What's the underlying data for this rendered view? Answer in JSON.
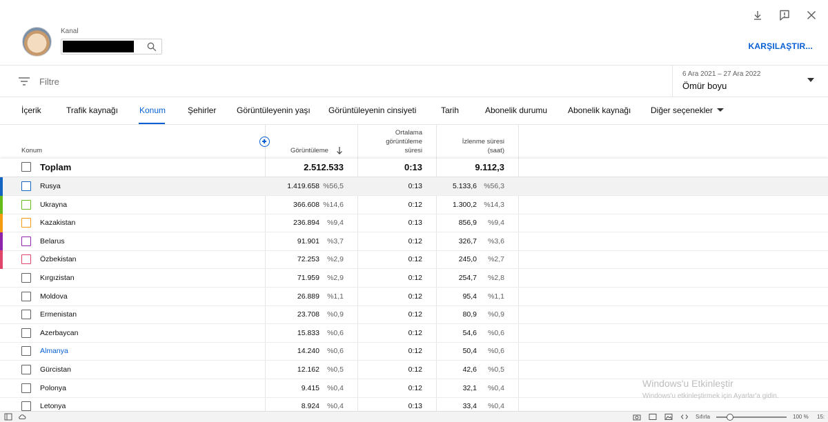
{
  "header": {
    "channel_label": "Kanal",
    "compare_label": "KARŞILAŞTIR..."
  },
  "filter": {
    "placeholder": "Filtre",
    "date_range_sub": "6 Ara 2021 – 27 Ara 2022",
    "date_range_main": "Ömür boyu"
  },
  "tabs": [
    {
      "label": "İçerik"
    },
    {
      "label": "Trafik kaynağı"
    },
    {
      "label": "Konum",
      "active": true
    },
    {
      "label": "Şehirler"
    },
    {
      "label": "Görüntüleyenin yaşı"
    },
    {
      "label": "Görüntüleyenin cinsiyeti"
    },
    {
      "label": "Tarih"
    },
    {
      "label": "Abonelik durumu"
    },
    {
      "label": "Abonelik kaynağı"
    },
    {
      "label": "Diğer seçenekler"
    }
  ],
  "table": {
    "col_location": "Konum",
    "col_views": "Görüntüleme",
    "col_avg_l1": "Ortalama",
    "col_avg_l2": "görüntüleme",
    "col_avg_l3": "süresi",
    "col_watch_l1": "İzlenme süresi",
    "col_watch_l2": "(saat)",
    "total": {
      "name": "Toplam",
      "views": "2.512.533",
      "avg": "0:13",
      "watch": "9.112,3"
    },
    "rows": [
      {
        "name": "Rusya",
        "views": "1.419.658",
        "views_pct": "%56,5",
        "avg": "0:13",
        "watch": "5.133,6",
        "watch_pct": "%56,3",
        "color": "#1565c0"
      },
      {
        "name": "Ukrayna",
        "views": "366.608",
        "views_pct": "%14,6",
        "avg": "0:12",
        "watch": "1.300,2",
        "watch_pct": "%14,3",
        "color": "#66bb1a"
      },
      {
        "name": "Kazakistan",
        "views": "236.894",
        "views_pct": "%9,4",
        "avg": "0:13",
        "watch": "856,9",
        "watch_pct": "%9,4",
        "color": "#f39c12"
      },
      {
        "name": "Belarus",
        "views": "91.901",
        "views_pct": "%3,7",
        "avg": "0:12",
        "watch": "326,7",
        "watch_pct": "%3,6",
        "color": "#8e24aa"
      },
      {
        "name": "Özbekistan",
        "views": "72.253",
        "views_pct": "%2,9",
        "avg": "0:12",
        "watch": "245,0",
        "watch_pct": "%2,7",
        "color": "#e0456a"
      },
      {
        "name": "Kırgızistan",
        "views": "71.959",
        "views_pct": "%2,9",
        "avg": "0:12",
        "watch": "254,7",
        "watch_pct": "%2,8"
      },
      {
        "name": "Moldova",
        "views": "26.889",
        "views_pct": "%1,1",
        "avg": "0:12",
        "watch": "95,4",
        "watch_pct": "%1,1"
      },
      {
        "name": "Ermenistan",
        "views": "23.708",
        "views_pct": "%0,9",
        "avg": "0:12",
        "watch": "80,9",
        "watch_pct": "%0,9"
      },
      {
        "name": "Azerbaycan",
        "views": "15.833",
        "views_pct": "%0,6",
        "avg": "0:12",
        "watch": "54,6",
        "watch_pct": "%0,6"
      },
      {
        "name": "Almanya",
        "views": "14.240",
        "views_pct": "%0,6",
        "avg": "0:12",
        "watch": "50,4",
        "watch_pct": "%0,6",
        "link": true
      },
      {
        "name": "Gürcistan",
        "views": "12.162",
        "views_pct": "%0,5",
        "avg": "0:12",
        "watch": "42,6",
        "watch_pct": "%0,5"
      },
      {
        "name": "Polonya",
        "views": "9.415",
        "views_pct": "%0,4",
        "avg": "0:12",
        "watch": "32,1",
        "watch_pct": "%0,4"
      },
      {
        "name": "Letonya",
        "views": "8.924",
        "views_pct": "%0,4",
        "avg": "0:13",
        "watch": "33,4",
        "watch_pct": "%0,4"
      }
    ]
  },
  "watermark": {
    "title": "Windows'u Etkinleştir",
    "subtitle": "Windows'u etkinleştirmek için Ayarlar'a gidin."
  },
  "statusbar": {
    "reset_label": "Sıfırla",
    "zoom_label": "100 %",
    "clock_fragment": "15:"
  },
  "colors": {
    "accent": "#065fd4"
  }
}
